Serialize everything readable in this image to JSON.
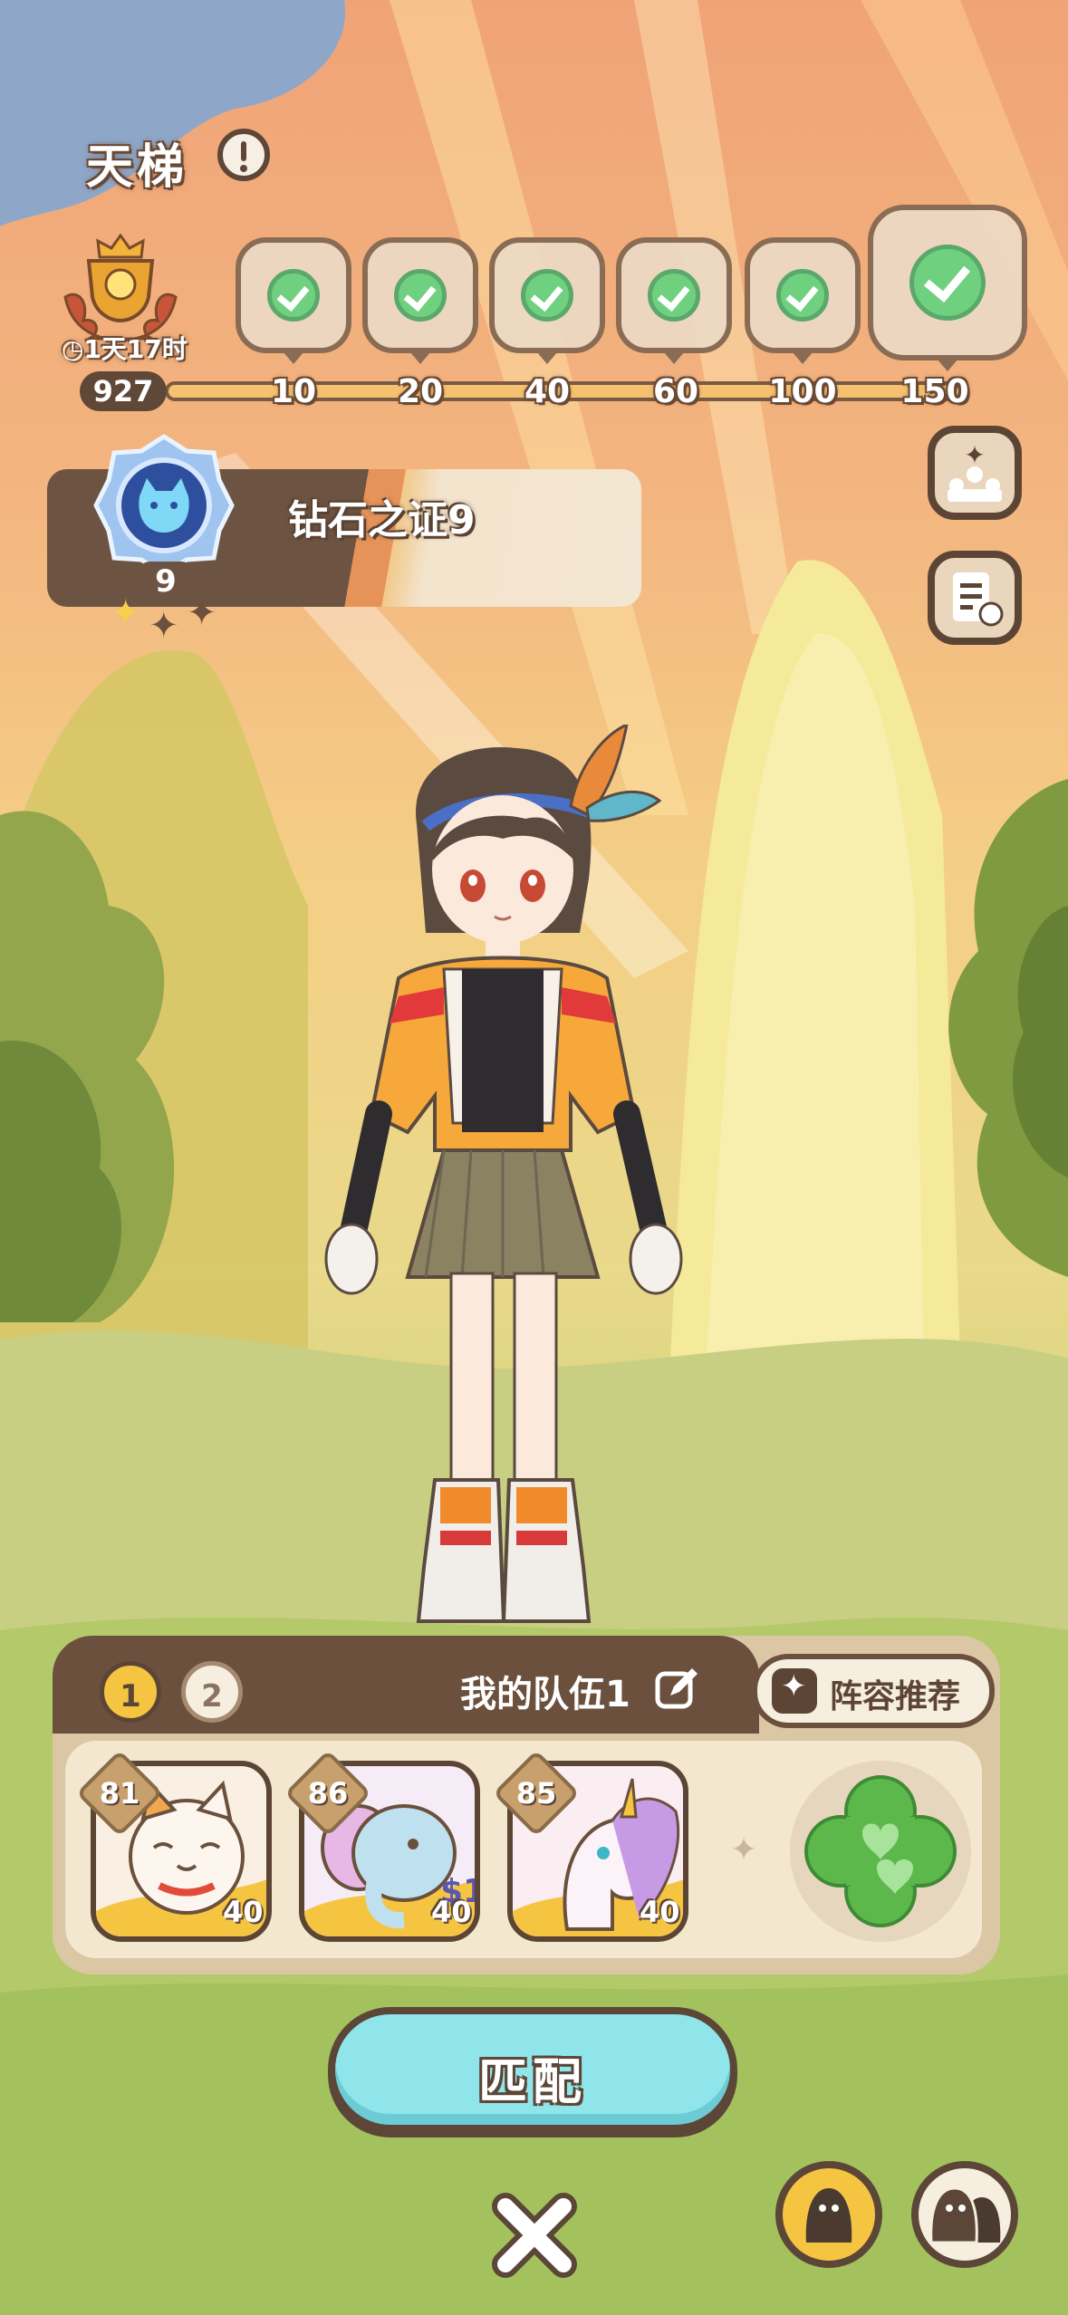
{
  "header": {
    "title": "天梯"
  },
  "season": {
    "timer": "1天17时"
  },
  "progress": {
    "current_score": "927",
    "milestones": [
      "10",
      "20",
      "40",
      "60",
      "100",
      "150"
    ]
  },
  "rank": {
    "name": "钻石之证9",
    "level": "9"
  },
  "team": {
    "tabs": [
      "1",
      "2"
    ],
    "name": "我的队伍1",
    "recommend_label": "阵容推荐",
    "members": [
      {
        "level": "81",
        "capacity": "40",
        "kind": "cat"
      },
      {
        "level": "86",
        "capacity": "40",
        "kind": "elephant"
      },
      {
        "level": "85",
        "capacity": "40",
        "kind": "unicorn"
      }
    ]
  },
  "actions": {
    "match_label": "匹配"
  },
  "colors": {
    "accent_teal": "#8fe5ea",
    "panel_brown": "#6b503d",
    "gold": "#f5c542",
    "check_green": "#6fd07f"
  }
}
